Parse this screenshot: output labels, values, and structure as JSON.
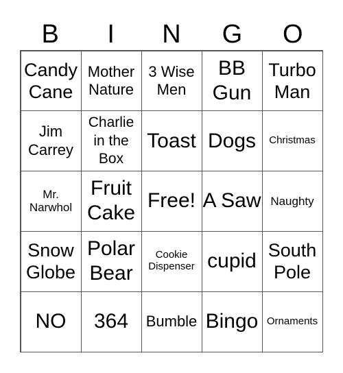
{
  "header": {
    "letters": [
      "B",
      "I",
      "N",
      "G",
      "O"
    ]
  },
  "cells": [
    {
      "text": "Candy Cane",
      "size": "s-m"
    },
    {
      "text": "Mother Nature",
      "size": "s-sm"
    },
    {
      "text": "3 Wise Men",
      "size": "s-sm"
    },
    {
      "text": "BB Gun",
      "size": "s-l"
    },
    {
      "text": "Turbo Man",
      "size": "s-m"
    },
    {
      "text": "Jim Carrey",
      "size": "s-sm"
    },
    {
      "text": "Charlie in the Box",
      "size": "s-s"
    },
    {
      "text": "Toast",
      "size": "s-l"
    },
    {
      "text": "Dogs",
      "size": "s-l"
    },
    {
      "text": "Christmas",
      "size": "s-xxs"
    },
    {
      "text": "Mr. Narwhol",
      "size": "s-xs"
    },
    {
      "text": "Fruit Cake",
      "size": "s-l"
    },
    {
      "text": "Free!",
      "size": "s-l"
    },
    {
      "text": "A Saw",
      "size": "s-l"
    },
    {
      "text": "Naughty",
      "size": "s-xs"
    },
    {
      "text": "Snow Globe",
      "size": "s-m"
    },
    {
      "text": "Polar Bear",
      "size": "s-l"
    },
    {
      "text": "Cookie Dispenser",
      "size": "s-xxs"
    },
    {
      "text": "cupid",
      "size": "s-l"
    },
    {
      "text": "South Pole",
      "size": "s-m"
    },
    {
      "text": "NO",
      "size": "s-l"
    },
    {
      "text": "364",
      "size": "s-l"
    },
    {
      "text": "Bumble",
      "size": "s-sm"
    },
    {
      "text": "Bingo",
      "size": "s-l"
    },
    {
      "text": "Ornaments",
      "size": "s-xxs"
    }
  ]
}
